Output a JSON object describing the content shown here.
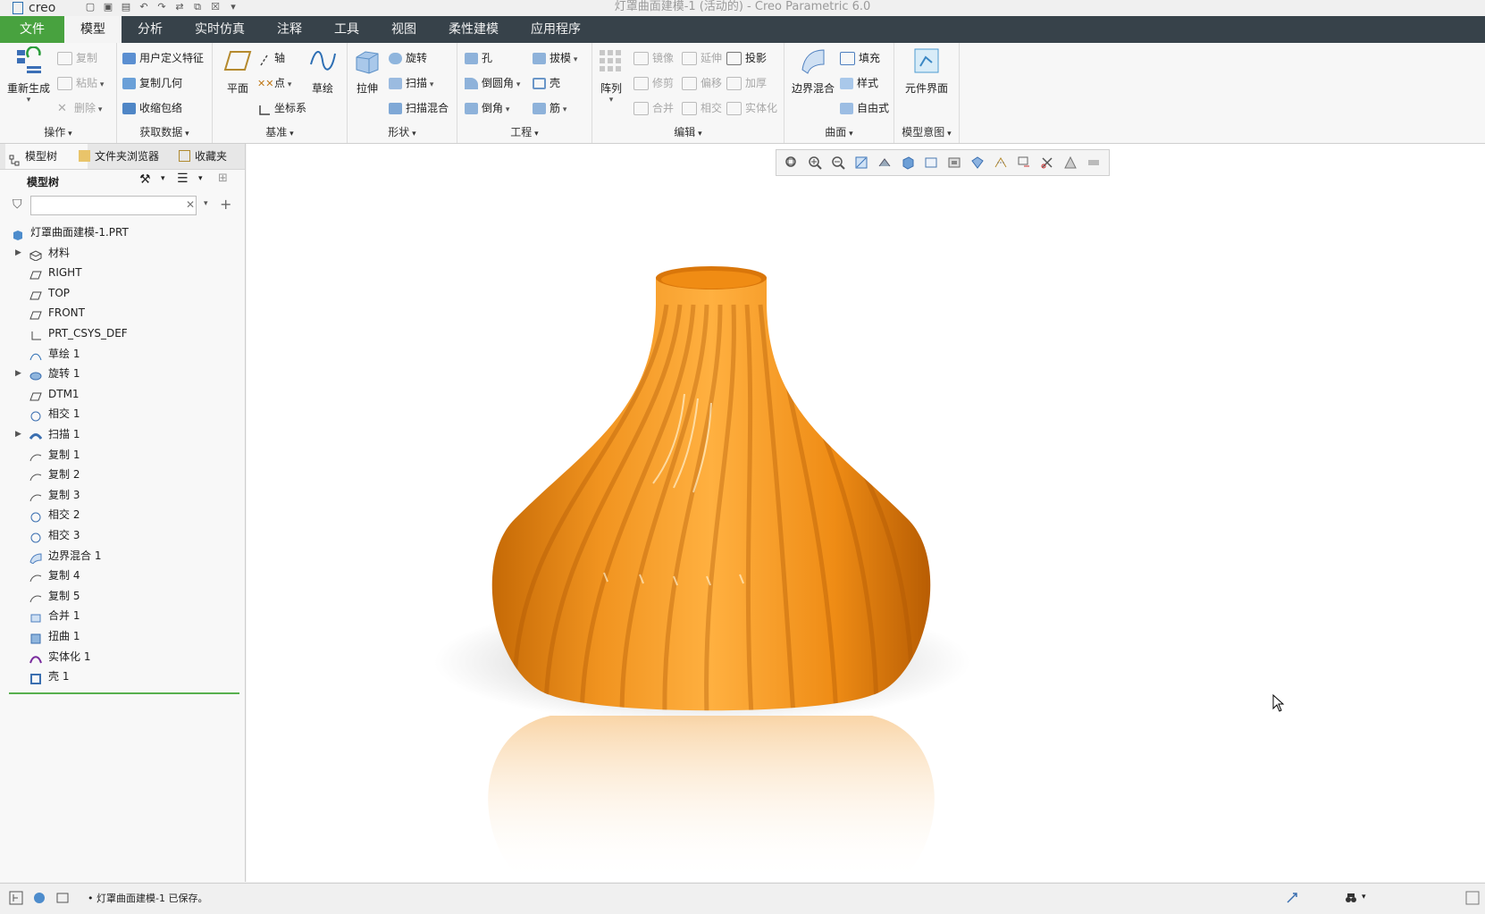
{
  "titlebar": {
    "app_logo": "creo",
    "window_title": "灯罩曲面建模-1 (活动的) - Creo Parametric 6.0"
  },
  "tabs": [
    {
      "label": "文件"
    },
    {
      "label": "模型"
    },
    {
      "label": "分析"
    },
    {
      "label": "实时仿真"
    },
    {
      "label": "注释"
    },
    {
      "label": "工具"
    },
    {
      "label": "视图"
    },
    {
      "label": "柔性建模"
    },
    {
      "label": "应用程序"
    }
  ],
  "ribbon": {
    "operations": {
      "regen": "重新生成",
      "copy": "复制",
      "paste": "粘贴",
      "delete": "删除",
      "label": "操作"
    },
    "get_data": {
      "udf": "用户定义特征",
      "copy_geom": "复制几何",
      "shrinkwrap": "收缩包络",
      "label": "获取数据"
    },
    "datum": {
      "plane": "平面",
      "axis": "轴",
      "point": "点",
      "csys": "坐标系",
      "sketch": "草绘",
      "label": "基准"
    },
    "shapes": {
      "extrude": "拉伸",
      "revolve": "旋转",
      "sweep": "扫描",
      "swept_blend": "扫描混合",
      "label": "形状"
    },
    "engineering": {
      "hole": "孔",
      "round": "倒圆角",
      "chamfer": "倒角",
      "draft": "拔模",
      "shell": "壳",
      "rib": "筋",
      "label": "工程"
    },
    "editing": {
      "pattern": "阵列",
      "mirror": "镜像",
      "trim": "修剪",
      "merge": "合并",
      "extend": "延伸",
      "offset": "偏移",
      "intersect": "相交",
      "project": "投影",
      "thicken": "加厚",
      "solidify": "实体化",
      "label": "编辑"
    },
    "surfaces": {
      "boundary_blend": "边界混合",
      "fill": "填充",
      "style": "样式",
      "freestyle": "自由式",
      "label": "曲面"
    },
    "model_intent": {
      "component_interface": "元件界面",
      "label": "模型意图"
    }
  },
  "panel": {
    "tabs": [
      "模型树",
      "文件夹浏览器",
      "收藏夹"
    ],
    "tree_title": "模型树",
    "search_placeholder": ""
  },
  "tree": [
    {
      "label": "灯罩曲面建模-1.PRT",
      "icon": "part-icon",
      "expandable": false
    },
    {
      "label": "材料",
      "icon": "material-icon",
      "expandable": true
    },
    {
      "label": "RIGHT",
      "icon": "datum-plane-icon",
      "expandable": false
    },
    {
      "label": "TOP",
      "icon": "datum-plane-icon",
      "expandable": false
    },
    {
      "label": "FRONT",
      "icon": "datum-plane-icon",
      "expandable": false
    },
    {
      "label": "PRT_CSYS_DEF",
      "icon": "csys-icon",
      "expandable": false
    },
    {
      "label": "草绘 1",
      "icon": "sketch-icon",
      "expandable": false
    },
    {
      "label": "旋转 1",
      "icon": "revolve-icon",
      "expandable": true
    },
    {
      "label": "DTM1",
      "icon": "datum-plane-icon",
      "expandable": false
    },
    {
      "label": "相交 1",
      "icon": "intersect-icon",
      "expandable": false
    },
    {
      "label": "扫描 1",
      "icon": "sweep-icon",
      "expandable": true
    },
    {
      "label": "复制 1",
      "icon": "copy-icon",
      "expandable": false
    },
    {
      "label": "复制 2",
      "icon": "copy-icon",
      "expandable": false
    },
    {
      "label": "复制 3",
      "icon": "copy-icon",
      "expandable": false
    },
    {
      "label": "相交 2",
      "icon": "intersect-icon",
      "expandable": false
    },
    {
      "label": "相交 3",
      "icon": "intersect-icon",
      "expandable": false
    },
    {
      "label": "边界混合 1",
      "icon": "boundary-blend-icon",
      "expandable": false
    },
    {
      "label": "复制 4",
      "icon": "copy-icon",
      "expandable": false
    },
    {
      "label": "复制 5",
      "icon": "copy-icon",
      "expandable": false
    },
    {
      "label": "合并 1",
      "icon": "merge-icon",
      "expandable": false
    },
    {
      "label": "扭曲 1",
      "icon": "warp-icon",
      "expandable": false
    },
    {
      "label": "实体化 1",
      "icon": "solidify-icon",
      "expandable": false
    },
    {
      "label": "壳 1",
      "icon": "shell-icon",
      "expandable": false
    }
  ],
  "status": {
    "message": "• 灯罩曲面建模-1 已保存。"
  },
  "colors": {
    "file_tab": "#48a23f",
    "tab_bar": "#37424a",
    "model_orange": "#f08c14",
    "insert_line": "#58b04e"
  }
}
